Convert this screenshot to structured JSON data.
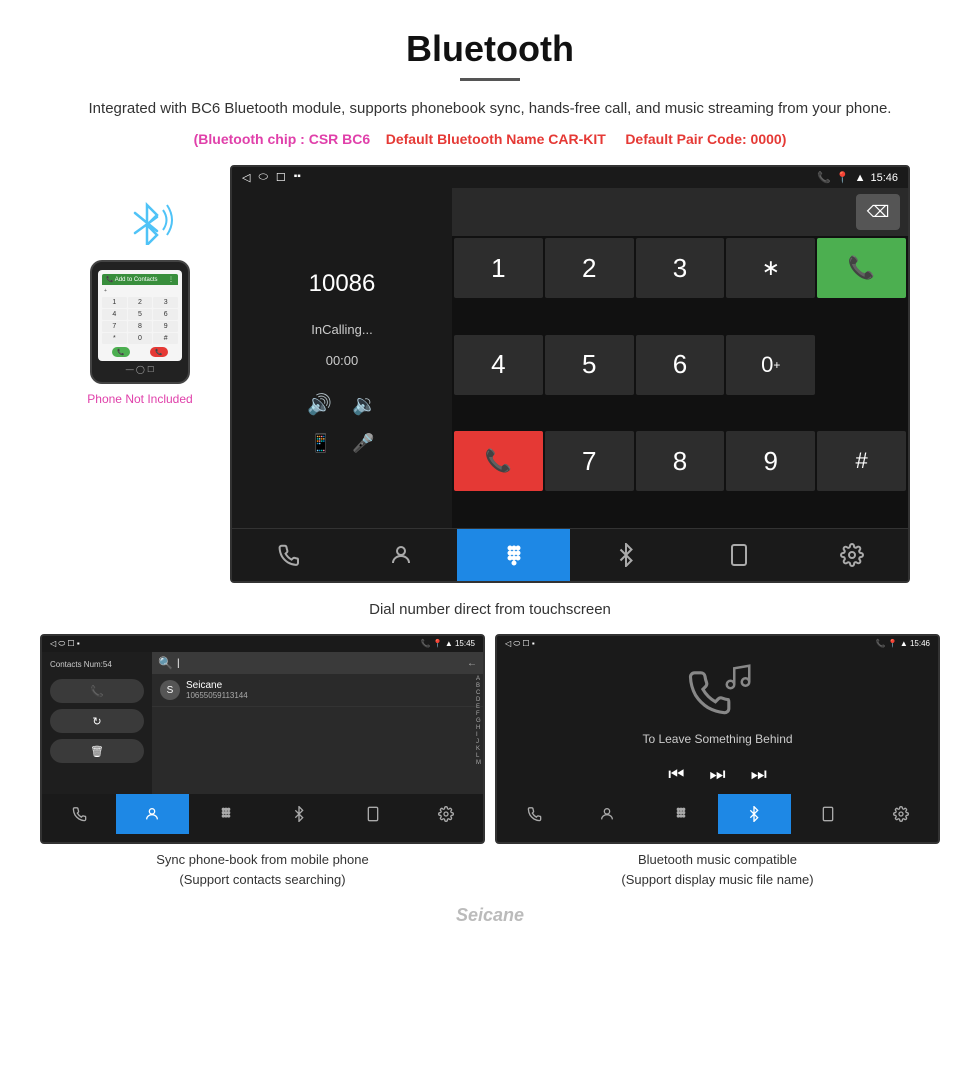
{
  "header": {
    "title": "Bluetooth",
    "description": "Integrated with BC6 Bluetooth module, supports phonebook sync, hands-free call, and music streaming from your phone.",
    "specs": {
      "chip": "(Bluetooth chip : CSR BC6",
      "name": "Default Bluetooth Name CAR-KIT",
      "pair": "Default Pair Code: 0000)"
    }
  },
  "main_screen": {
    "status_bar": {
      "left": [
        "◁",
        "⬭",
        "☐"
      ],
      "right_icons": [
        "📞",
        "📍",
        "WiFi"
      ],
      "time": "15:46"
    },
    "dial": {
      "number": "10086",
      "status": "InCalling...",
      "timer": "00:00"
    },
    "numpad": {
      "keys": [
        "1",
        "2",
        "3",
        "*",
        "4",
        "5",
        "6",
        "0+",
        "7",
        "8",
        "9",
        "#"
      ]
    },
    "caption": "Dial number direct from touchscreen"
  },
  "phone_side": {
    "not_included": "Phone Not Included"
  },
  "bottom_left_screen": {
    "status_time": "15:45",
    "contacts_num": "Contacts Num:54",
    "search_placeholder": "Search",
    "contact": {
      "name": "Seicane",
      "number": "10655059113144"
    },
    "alphabet": [
      "A",
      "B",
      "C",
      "D",
      "E",
      "F",
      "G",
      "H",
      "I",
      "J",
      "K",
      "L",
      "M"
    ],
    "buttons": [
      "📞",
      "↻",
      "🗑"
    ],
    "caption_line1": "Sync phone-book from mobile phone",
    "caption_line2": "(Support contacts searching)"
  },
  "bottom_right_screen": {
    "status_time": "15:46",
    "music_title": "To Leave Something Behind",
    "caption_line1": "Bluetooth music compatible",
    "caption_line2": "(Support display music file name)"
  },
  "nav_items": {
    "phone": "📞",
    "contacts": "👤",
    "dialpad": "⌨",
    "bluetooth": "✱",
    "transfer": "📱",
    "settings": "⚙"
  },
  "watermark": "Seicane"
}
